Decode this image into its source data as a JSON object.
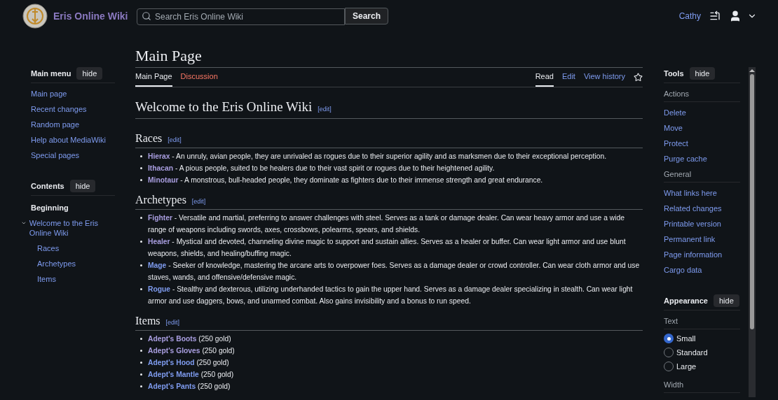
{
  "header": {
    "site_name": "Eris Online Wiki",
    "search": {
      "placeholder": "Search Eris Online Wiki",
      "button": "Search"
    },
    "user": "Cathy"
  },
  "main_menu": {
    "title": "Main menu",
    "hide": "hide",
    "items": [
      "Main page",
      "Recent changes",
      "Random page",
      "Help about MediaWiki",
      "Special pages"
    ]
  },
  "contents": {
    "title": "Contents",
    "hide": "hide",
    "beginning": "Beginning",
    "items": [
      {
        "label": "Welcome to the Eris Online Wiki",
        "expanded": true,
        "children": [
          {
            "label": "Races"
          },
          {
            "label": "Archetypes"
          },
          {
            "label": "Items"
          }
        ]
      }
    ]
  },
  "page": {
    "title": "Main Page",
    "tabs": [
      {
        "label": "Main Page",
        "selected": true,
        "exists": true
      },
      {
        "label": "Discussion",
        "selected": false,
        "exists": false
      }
    ],
    "actions": [
      {
        "label": "Read",
        "selected": true
      },
      {
        "label": "Edit",
        "selected": false
      },
      {
        "label": "View history",
        "selected": false
      }
    ],
    "heading": "Welcome to the Eris Online Wiki",
    "heading_edit": "[edit]",
    "sections": [
      {
        "title": "Races",
        "edit": "[edit]",
        "items": [
          {
            "link": "Hierax",
            "visited": true,
            "text": " - An unruly, avian people, they are unrivaled as rogues due to their superior agility and as marksmen due to their exceptional perception."
          },
          {
            "link": "Ithacan",
            "visited": true,
            "text": " - A pious people, suited to be healers due to their vast spirit or rogues due to their heightened agility."
          },
          {
            "link": "Minotaur",
            "visited": true,
            "text": " - A monstrous, bull-headed people, they dominate as fighters due to their immense strength and great endurance."
          }
        ]
      },
      {
        "title": "Archetypes",
        "edit": "[edit]",
        "items": [
          {
            "link": "Fighter",
            "visited": true,
            "text": " - Versatile and martial, preferring to answer challenges with steel. Serves as a tank or damage dealer. Can wear heavy armor and use a wide range of weapons including swords, axes, crossbows, polearms, spears, and shields."
          },
          {
            "link": "Healer",
            "visited": true,
            "text": " - Mystical and devoted, channeling divine magic to support and sustain allies. Serves as a healer or buffer. Can wear light armor and use blunt weapons, shields, and healing/buffing magic."
          },
          {
            "link": "Mage",
            "visited": false,
            "text": " - Seeker of knowledge, mastering the arcane arts to overpower foes. Serves as a damage dealer or crowd controller. Can wear cloth armor and use staves, wands, and offensive/defensive magic."
          },
          {
            "link": "Rogue",
            "visited": false,
            "text": " - Stealthy and dexterous, utilizing underhanded tactics to gain the upper hand. Serves as a damage dealer specializing in stealth. Can wear light armor and use daggers, bows, and unarmed combat. Also gains invisibility and a bonus to run speed."
          }
        ]
      },
      {
        "title": "Items",
        "edit": "[edit]",
        "items": [
          {
            "link": "Adept's Boots",
            "visited": true,
            "text": " (250 gold)"
          },
          {
            "link": "Adept's Gloves",
            "visited": true,
            "text": " (250 gold)"
          },
          {
            "link": "Adept's Hood",
            "visited": false,
            "text": " (250 gold)"
          },
          {
            "link": "Adept's Mantle",
            "visited": false,
            "text": " (250 gold)"
          },
          {
            "link": "Adept's Pants",
            "visited": false,
            "text": " (250 gold)"
          }
        ]
      }
    ]
  },
  "tools": {
    "title": "Tools",
    "hide": "hide",
    "groups": [
      {
        "heading": "Actions",
        "items": [
          "Delete",
          "Move",
          "Protect",
          "Purge cache"
        ]
      },
      {
        "heading": "General",
        "items": [
          "What links here",
          "Related changes",
          "Printable version",
          "Permanent link",
          "Page information",
          "Cargo data"
        ]
      }
    ]
  },
  "appearance": {
    "title": "Appearance",
    "hide": "hide",
    "text_heading": "Text",
    "options": [
      {
        "label": "Small",
        "selected": true
      },
      {
        "label": "Standard",
        "selected": false
      },
      {
        "label": "Large",
        "selected": false
      }
    ],
    "width_heading": "Width"
  }
}
